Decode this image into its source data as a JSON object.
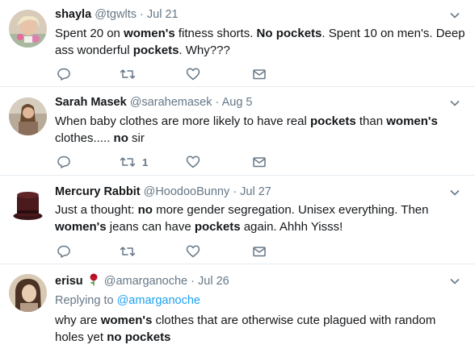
{
  "tweets": [
    {
      "name": "shayla",
      "handle": "@tgwlts",
      "separator": "·",
      "date": "Jul 21",
      "text_segments": [
        {
          "t": "Spent 20 on ",
          "b": false
        },
        {
          "t": "women's",
          "b": true
        },
        {
          "t": " fitness shorts. ",
          "b": false
        },
        {
          "t": "No pockets",
          "b": true
        },
        {
          "t": ". Spent 10 on men's. Deep ass wonderful ",
          "b": false
        },
        {
          "t": "pockets",
          "b": true
        },
        {
          "t": ". Why???",
          "b": false
        }
      ],
      "retweet_count": ""
    },
    {
      "name": "Sarah Masek",
      "handle": "@sarahemasek",
      "separator": "·",
      "date": "Aug 5",
      "text_segments": [
        {
          "t": "When baby clothes are more likely to have real ",
          "b": false
        },
        {
          "t": "pockets",
          "b": true
        },
        {
          "t": " than ",
          "b": false
        },
        {
          "t": "women's",
          "b": true
        },
        {
          "t": " clothes..... ",
          "b": false
        },
        {
          "t": "no",
          "b": true
        },
        {
          "t": " sir",
          "b": false
        }
      ],
      "retweet_count": "1"
    },
    {
      "name": "Mercury Rabbit",
      "handle": "@HoodooBunny",
      "separator": "·",
      "date": "Jul 27",
      "text_segments": [
        {
          "t": "Just a thought:  ",
          "b": false
        },
        {
          "t": "no",
          "b": true
        },
        {
          "t": " more gender segregation.  Unisex everything.  Then ",
          "b": false
        },
        {
          "t": "women's",
          "b": true
        },
        {
          "t": " jeans can have ",
          "b": false
        },
        {
          "t": "pockets",
          "b": true
        },
        {
          "t": " again.  Ahhh Yisss!",
          "b": false
        }
      ],
      "retweet_count": ""
    },
    {
      "name": "erisu",
      "name_emoji": "rose-emoji",
      "handle": "@amarganoche",
      "separator": "·",
      "date": "Jul 26",
      "reply_prefix": "Replying to",
      "reply_handle": "@amarganoche",
      "text_segments": [
        {
          "t": "why are ",
          "b": false
        },
        {
          "t": "women's",
          "b": true
        },
        {
          "t": " clothes that are otherwise cute plagued with random holes yet ",
          "b": false
        },
        {
          "t": "no pockets",
          "b": true
        }
      ],
      "retweet_count": ""
    }
  ],
  "icons": {
    "reply": "reply-icon",
    "retweet": "retweet-icon",
    "like": "heart-icon",
    "dm": "envelope-icon",
    "menu": "chevron-down-icon"
  },
  "colors": {
    "name": "#14171a",
    "secondary": "#657786",
    "link": "#1da1f2",
    "divider": "#e6ecf0",
    "rose": "#c0142b"
  }
}
